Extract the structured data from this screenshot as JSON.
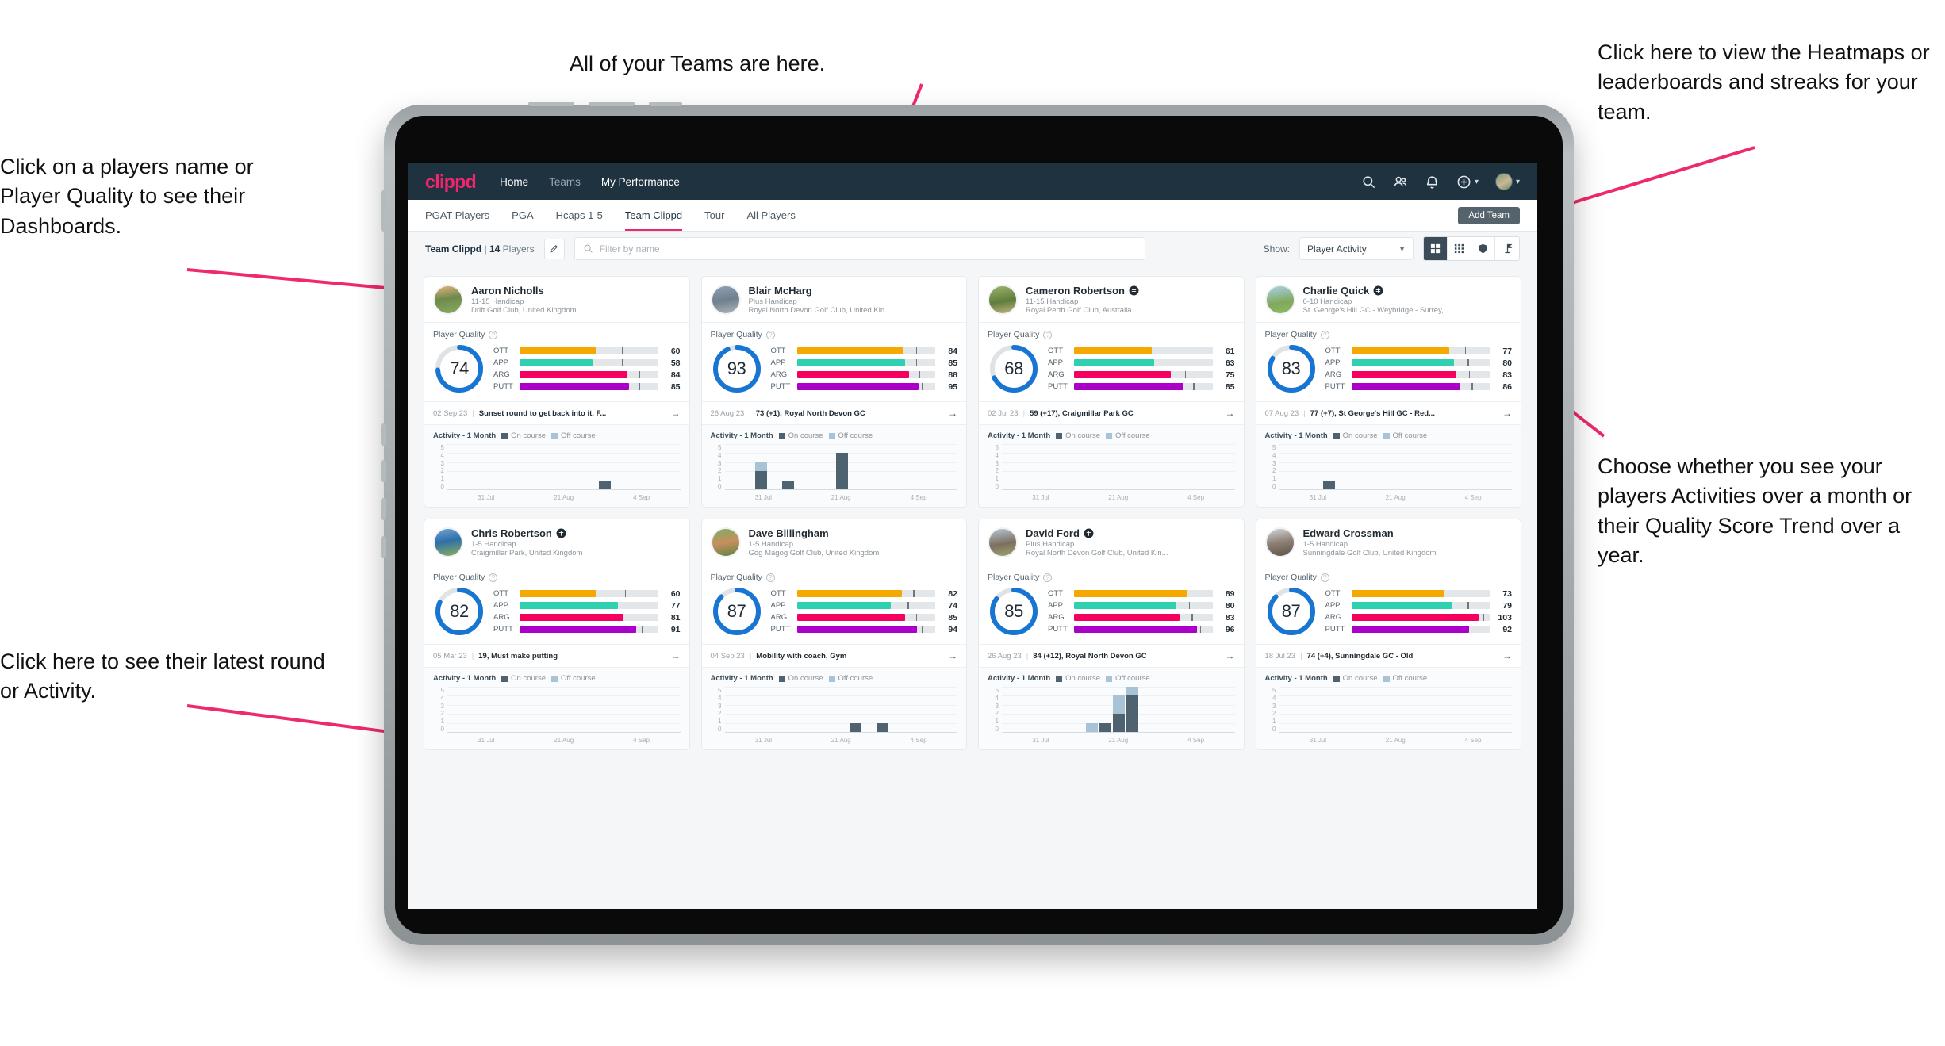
{
  "annotations": [
    {
      "id": "players-name",
      "text": "Click on a players name or Player Quality to see their Dashboards."
    },
    {
      "id": "teams",
      "text": "All of your Teams are here."
    },
    {
      "id": "heatmaps",
      "text": "Click here to view the Heatmaps or leaderboards and streaks for your team."
    },
    {
      "id": "activity-choice",
      "text": "Choose whether you see your players Activities over a month or their Quality Score Trend over a year."
    },
    {
      "id": "latest-round",
      "text": "Click here to see their latest round or Activity."
    }
  ],
  "colors": {
    "brand_pink": "#f0256e",
    "nav_dark": "#1f3240",
    "ring_blue": "#1876d2",
    "ott": "#f5a800",
    "app": "#2fd0b0",
    "arg": "#f5005e",
    "putt": "#aa00c7",
    "on_course": "#4e6270",
    "off_course": "#a8c3d6"
  },
  "topnav": {
    "brand": "clippd",
    "links": [
      {
        "label": "Home",
        "active": true
      },
      {
        "label": "Teams",
        "active": false
      },
      {
        "label": "My Performance",
        "active": true
      }
    ],
    "icons": [
      "search-icon",
      "people-icon",
      "bell-icon",
      "plus-circle-icon",
      "avatar"
    ]
  },
  "tabs": [
    {
      "label": "PGAT Players",
      "active": false
    },
    {
      "label": "PGA",
      "active": false
    },
    {
      "label": "Hcaps 1-5",
      "active": false
    },
    {
      "label": "Team Clippd",
      "active": true
    },
    {
      "label": "Tour",
      "active": false
    },
    {
      "label": "All Players",
      "active": false
    }
  ],
  "add_team_label": "Add Team",
  "toolbar": {
    "team_name": "Team Clippd",
    "player_count": "14",
    "players_word": "Players",
    "separator": "|",
    "search_placeholder": "Filter by name",
    "show_label": "Show:",
    "show_value": "Player Activity",
    "view_buttons": [
      "grid-large-icon",
      "grid-small-icon",
      "shield-icon",
      "flag-icon"
    ]
  },
  "card_labels": {
    "player_quality": "Player Quality",
    "activity": "Activity - 1 Month",
    "legend_on": "On course",
    "legend_off": "Off course",
    "bar_labels": [
      "OTT",
      "APP",
      "ARG",
      "PUTT"
    ],
    "y_ticks": [
      "5",
      "4",
      "3",
      "2",
      "1",
      "0"
    ],
    "x_ticks": [
      "31 Jul",
      "21 Aug",
      "4 Sep"
    ]
  },
  "players": [
    {
      "name": "Aaron Nicholls",
      "verified": false,
      "handicap": "11-15 Handicap",
      "club": "Drift Golf Club, United Kingdom",
      "quality": "74",
      "metrics": [
        {
          "label": "OTT",
          "value": "60",
          "fill": 55,
          "tick": 74
        },
        {
          "label": "APP",
          "value": "58",
          "fill": 53,
          "tick": 74
        },
        {
          "label": "ARG",
          "value": "84",
          "fill": 78,
          "tick": 86
        },
        {
          "label": "PUTT",
          "value": "85",
          "fill": 79,
          "tick": 86
        }
      ],
      "latest_date": "02 Sep 23",
      "latest_desc": "Sunset round to get back into it, F...",
      "chart": {
        "on": [
          0,
          0,
          0,
          0,
          0,
          0,
          0,
          0,
          0,
          0,
          0,
          1,
          0,
          0
        ],
        "off": [
          0,
          0,
          0,
          0,
          0,
          0,
          0,
          0,
          0,
          0,
          0,
          0,
          0,
          0
        ]
      }
    },
    {
      "name": "Blair McHarg",
      "verified": false,
      "handicap": "Plus Handicap",
      "club": "Royal North Devon Golf Club, United Kin...",
      "quality": "93",
      "metrics": [
        {
          "label": "OTT",
          "value": "84",
          "fill": 77,
          "tick": 86
        },
        {
          "label": "APP",
          "value": "85",
          "fill": 78,
          "tick": 86
        },
        {
          "label": "ARG",
          "value": "88",
          "fill": 81,
          "tick": 88
        },
        {
          "label": "PUTT",
          "value": "95",
          "fill": 88,
          "tick": 90
        }
      ],
      "latest_date": "26 Aug 23",
      "latest_desc": "73 (+1), Royal North Devon GC",
      "chart": {
        "on": [
          0,
          0,
          2,
          0,
          1,
          0,
          0,
          0,
          4,
          0,
          0,
          0,
          0,
          0
        ],
        "off": [
          0,
          0,
          1,
          0,
          0,
          0,
          0,
          0,
          0,
          0,
          0,
          0,
          0,
          0
        ]
      }
    },
    {
      "name": "Cameron Robertson",
      "verified": true,
      "handicap": "11-15 Handicap",
      "club": "Royal Perth Golf Club, Australia",
      "quality": "68",
      "metrics": [
        {
          "label": "OTT",
          "value": "61",
          "fill": 56,
          "tick": 76
        },
        {
          "label": "APP",
          "value": "63",
          "fill": 58,
          "tick": 76
        },
        {
          "label": "ARG",
          "value": "75",
          "fill": 70,
          "tick": 80
        },
        {
          "label": "PUTT",
          "value": "85",
          "fill": 79,
          "tick": 86
        }
      ],
      "latest_date": "02 Jul 23",
      "latest_desc": "59 (+17), Craigmillar Park GC",
      "chart": {
        "on": [
          0,
          0,
          0,
          0,
          0,
          0,
          0,
          0,
          0,
          0,
          0,
          0,
          0,
          0
        ],
        "off": [
          0,
          0,
          0,
          0,
          0,
          0,
          0,
          0,
          0,
          0,
          0,
          0,
          0,
          0
        ]
      }
    },
    {
      "name": "Charlie Quick",
      "verified": true,
      "handicap": "6-10 Handicap",
      "club": "St. George's Hill GC - Weybridge - Surrey, ...",
      "quality": "83",
      "metrics": [
        {
          "label": "OTT",
          "value": "77",
          "fill": 71,
          "tick": 82
        },
        {
          "label": "APP",
          "value": "80",
          "fill": 74,
          "tick": 84
        },
        {
          "label": "ARG",
          "value": "83",
          "fill": 76,
          "tick": 85
        },
        {
          "label": "PUTT",
          "value": "86",
          "fill": 79,
          "tick": 87
        }
      ],
      "latest_date": "07 Aug 23",
      "latest_desc": "77 (+7), St George's Hill GC - Red...",
      "chart": {
        "on": [
          0,
          0,
          0,
          1,
          0,
          0,
          0,
          0,
          0,
          0,
          0,
          0,
          0,
          0
        ],
        "off": [
          0,
          0,
          0,
          0,
          0,
          0,
          0,
          0,
          0,
          0,
          0,
          0,
          0,
          0
        ]
      }
    },
    {
      "name": "Chris Robertson",
      "verified": true,
      "handicap": "1-5 Handicap",
      "club": "Craigmillar Park, United Kingdom",
      "quality": "82",
      "metrics": [
        {
          "label": "OTT",
          "value": "60",
          "fill": 55,
          "tick": 76
        },
        {
          "label": "APP",
          "value": "77",
          "fill": 71,
          "tick": 80
        },
        {
          "label": "ARG",
          "value": "81",
          "fill": 75,
          "tick": 83
        },
        {
          "label": "PUTT",
          "value": "91",
          "fill": 84,
          "tick": 88
        }
      ],
      "latest_date": "05 Mar 23",
      "latest_desc": "19, Must make putting",
      "chart": {
        "on": [
          0,
          0,
          0,
          0,
          0,
          0,
          0,
          0,
          0,
          0,
          0,
          0,
          0,
          0
        ],
        "off": [
          0,
          0,
          0,
          0,
          0,
          0,
          0,
          0,
          0,
          0,
          0,
          0,
          0,
          0
        ]
      }
    },
    {
      "name": "Dave Billingham",
      "verified": false,
      "handicap": "1-5 Handicap",
      "club": "Gog Magog Golf Club, United Kingdom",
      "quality": "87",
      "metrics": [
        {
          "label": "OTT",
          "value": "82",
          "fill": 76,
          "tick": 84
        },
        {
          "label": "APP",
          "value": "74",
          "fill": 68,
          "tick": 80
        },
        {
          "label": "ARG",
          "value": "85",
          "fill": 78,
          "tick": 86
        },
        {
          "label": "PUTT",
          "value": "94",
          "fill": 87,
          "tick": 90
        }
      ],
      "latest_date": "04 Sep 23",
      "latest_desc": "Mobility with coach, Gym",
      "chart": {
        "on": [
          0,
          0,
          0,
          0,
          0,
          0,
          0,
          0,
          0,
          1,
          0,
          1,
          0,
          0
        ],
        "off": [
          0,
          0,
          0,
          0,
          0,
          0,
          0,
          0,
          0,
          0,
          0,
          0,
          0,
          0
        ]
      }
    },
    {
      "name": "David Ford",
      "verified": true,
      "handicap": "Plus Handicap",
      "club": "Royal North Devon Golf Club, United Kin...",
      "quality": "85",
      "metrics": [
        {
          "label": "OTT",
          "value": "89",
          "fill": 82,
          "tick": 87
        },
        {
          "label": "APP",
          "value": "80",
          "fill": 74,
          "tick": 83
        },
        {
          "label": "ARG",
          "value": "83",
          "fill": 76,
          "tick": 85
        },
        {
          "label": "PUTT",
          "value": "96",
          "fill": 89,
          "tick": 91
        }
      ],
      "latest_date": "26 Aug 23",
      "latest_desc": "84 (+12), Royal North Devon GC",
      "chart": {
        "on": [
          0,
          0,
          0,
          0,
          0,
          0,
          0,
          1,
          2,
          4,
          0,
          0,
          0,
          0
        ],
        "off": [
          0,
          0,
          0,
          0,
          0,
          0,
          1,
          0,
          2,
          1,
          0,
          0,
          0,
          0
        ]
      }
    },
    {
      "name": "Edward Crossman",
      "verified": false,
      "handicap": "1-5 Handicap",
      "club": "Sunningdale Golf Club, United Kingdom",
      "quality": "87",
      "metrics": [
        {
          "label": "OTT",
          "value": "73",
          "fill": 67,
          "tick": 81
        },
        {
          "label": "APP",
          "value": "79",
          "fill": 73,
          "tick": 84
        },
        {
          "label": "ARG",
          "value": "103",
          "fill": 92,
          "tick": 95
        },
        {
          "label": "PUTT",
          "value": "92",
          "fill": 85,
          "tick": 89
        }
      ],
      "latest_date": "18 Jul 23",
      "latest_desc": "74 (+4), Sunningdale GC - Old",
      "chart": {
        "on": [
          0,
          0,
          0,
          0,
          0,
          0,
          0,
          0,
          0,
          0,
          0,
          0,
          0,
          0
        ],
        "off": [
          0,
          0,
          0,
          0,
          0,
          0,
          0,
          0,
          0,
          0,
          0,
          0,
          0,
          0
        ]
      }
    }
  ]
}
